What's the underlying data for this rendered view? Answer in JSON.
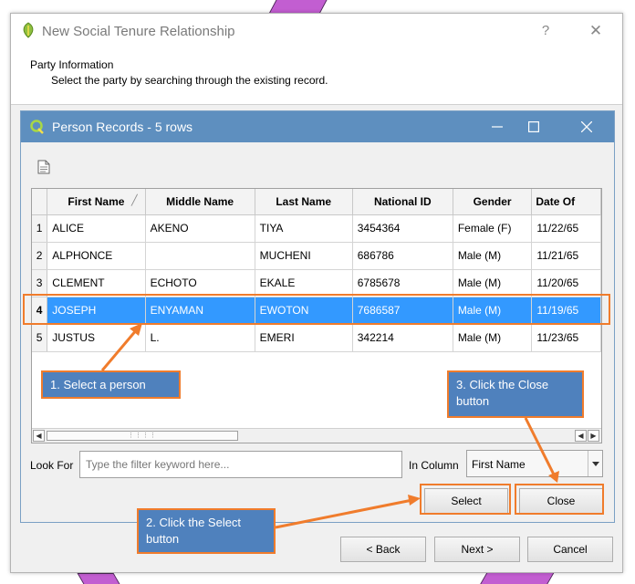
{
  "outer_window": {
    "title": "New Social Tenure Relationship",
    "help_glyph": "?",
    "close_glyph": "✕",
    "party_heading": "Party Information",
    "party_subtitle": "Select the party by searching through the existing record."
  },
  "inner_window": {
    "title": "Person Records - 5 rows"
  },
  "table": {
    "columns": [
      "First Name",
      "Middle Name",
      "Last Name",
      "National ID",
      "Gender",
      "Date Of"
    ],
    "rows": [
      {
        "num": "1",
        "cells": [
          "ALICE",
          "AKENO",
          "TIYA",
          "3454364",
          "Female (F)",
          "11/22/65"
        ]
      },
      {
        "num": "2",
        "cells": [
          "ALPHONCE",
          "",
          "MUCHENI",
          "686786",
          "Male (M)",
          "11/21/65"
        ]
      },
      {
        "num": "3",
        "cells": [
          "CLEMENT",
          "ECHOTO",
          "EKALE",
          "6785678",
          "Male (M)",
          "11/20/65"
        ]
      },
      {
        "num": "4",
        "cells": [
          "JOSEPH",
          "ENYAMAN",
          "EWOTON",
          "7686587",
          "Male (M)",
          "11/19/65"
        ]
      },
      {
        "num": "5",
        "cells": [
          "JUSTUS",
          "L.",
          "EMERI",
          "342214",
          "Male (M)",
          "11/23/65"
        ]
      }
    ],
    "selected_row": "4"
  },
  "filter": {
    "look_for_label": "Look For",
    "placeholder": "Type the filter keyword here...",
    "in_column_label": "In Column",
    "column_value": "First Name"
  },
  "buttons": {
    "select": "Select",
    "close": "Close",
    "back": "< Back",
    "next": "Next >",
    "cancel": "Cancel"
  },
  "callouts": {
    "step1": "1. Select a person",
    "step2": "2. Click the Select button",
    "step3": "3. Click the Close button"
  },
  "colors": {
    "inner_title_bar": "#5e8fbf",
    "selection": "#3399ff",
    "callout_fill": "#4f81bd",
    "highlight": "#f07c2c"
  }
}
